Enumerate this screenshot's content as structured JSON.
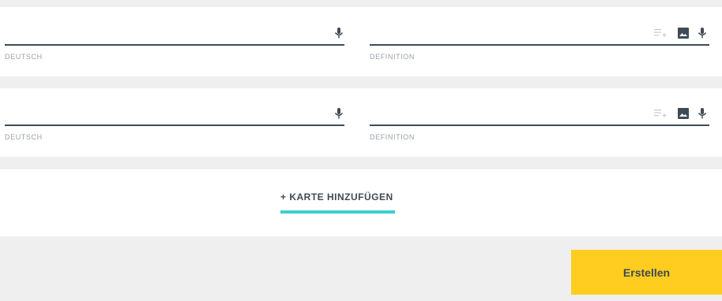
{
  "cards": [
    {
      "term": {
        "label": "DEUTSCH",
        "value": ""
      },
      "definition": {
        "label": "DEFINITION",
        "value": ""
      }
    },
    {
      "term": {
        "label": "DEUTSCH",
        "value": ""
      },
      "definition": {
        "label": "DEFINITION",
        "value": ""
      }
    }
  ],
  "add_card_label": "+ KARTE HINZUFÜGEN",
  "create_button_label": "Erstellen",
  "icons": {
    "term_field": [
      "microphone-icon"
    ],
    "definition_field": [
      "list-add-icon",
      "image-icon",
      "microphone-icon"
    ]
  },
  "colors": {
    "accent_yellow": "#ffcd1f",
    "accent_teal": "#3ccfcf",
    "text_dark": "#3f4a55",
    "label_gray": "#9aa1a8",
    "background_gray": "#efefef"
  }
}
